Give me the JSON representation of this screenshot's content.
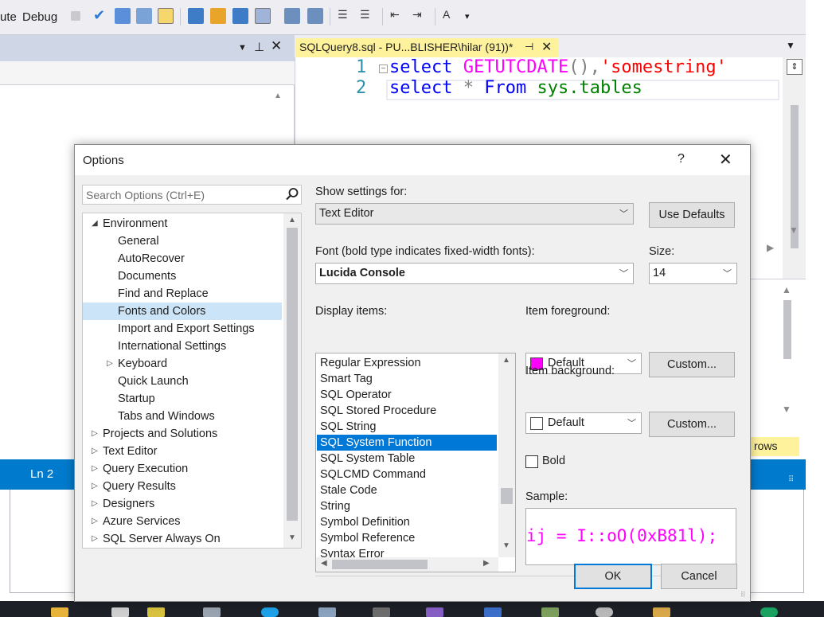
{
  "menubar": {
    "items": [
      "ute",
      "Debug"
    ]
  },
  "editor": {
    "tab_title": "SQLQuery8.sql - PU...BLISHER\\hilar (91))*",
    "line_numbers": [
      "1",
      "2"
    ],
    "line1": {
      "kw": "select",
      "fn": "GETUTCDATE",
      "paren": "()",
      "comma": ",",
      "str": "'somestring'"
    },
    "line2": {
      "kw": "select",
      "star": "*",
      "from": "From",
      "tbl": "sys.tables"
    }
  },
  "results_tag": "rows",
  "statusbar": {
    "line": "Ln 2"
  },
  "dialog": {
    "title": "Options",
    "help_glyph": "?",
    "search_placeholder": "Search Options (Ctrl+E)",
    "tree": [
      {
        "label": "Environment",
        "level": 0,
        "arrow": "expanded"
      },
      {
        "label": "General",
        "level": 1,
        "arrow": "none"
      },
      {
        "label": "AutoRecover",
        "level": 1,
        "arrow": "none"
      },
      {
        "label": "Documents",
        "level": 1,
        "arrow": "none"
      },
      {
        "label": "Find and Replace",
        "level": 1,
        "arrow": "none"
      },
      {
        "label": "Fonts and Colors",
        "level": 1,
        "arrow": "none",
        "selected": true
      },
      {
        "label": "Import and Export Settings",
        "level": 1,
        "arrow": "none"
      },
      {
        "label": "International Settings",
        "level": 1,
        "arrow": "none"
      },
      {
        "label": "Keyboard",
        "level": 1,
        "arrow": "collapsed"
      },
      {
        "label": "Quick Launch",
        "level": 1,
        "arrow": "none"
      },
      {
        "label": "Startup",
        "level": 1,
        "arrow": "none"
      },
      {
        "label": "Tabs and Windows",
        "level": 1,
        "arrow": "none"
      },
      {
        "label": "Projects and Solutions",
        "level": 0,
        "arrow": "collapsed"
      },
      {
        "label": "Text Editor",
        "level": 0,
        "arrow": "collapsed"
      },
      {
        "label": "Query Execution",
        "level": 0,
        "arrow": "collapsed"
      },
      {
        "label": "Query Results",
        "level": 0,
        "arrow": "collapsed"
      },
      {
        "label": "Designers",
        "level": 0,
        "arrow": "collapsed"
      },
      {
        "label": "Azure Services",
        "level": 0,
        "arrow": "collapsed"
      },
      {
        "label": "SQL Server Always On",
        "level": 0,
        "arrow": "collapsed"
      }
    ],
    "show_settings_label": "Show settings for:",
    "show_settings_value": "Text Editor",
    "use_defaults": "Use Defaults",
    "font_label": "Font (bold type indicates fixed-width fonts):",
    "font_value": "Lucida Console",
    "size_label": "Size:",
    "size_value": "14",
    "display_items_label": "Display items:",
    "display_items": [
      "Regular Expression",
      "Smart Tag",
      "SQL Operator",
      "SQL Stored Procedure",
      "SQL String",
      "SQL System Function",
      "SQL System Table",
      "SQLCMD Command",
      "Stale Code",
      "String",
      "Symbol Definition",
      "Symbol Reference",
      "Syntax Error"
    ],
    "selected_display_item": "SQL System Function",
    "item_fg_label": "Item foreground:",
    "item_fg_value": "Default",
    "item_fg_color": "#ff00ff",
    "item_bg_label": "Item background:",
    "item_bg_value": "Default",
    "item_bg_color": "#ffffff",
    "custom_label": "Custom...",
    "bold_label": "Bold",
    "bold_checked": false,
    "sample_label": "Sample:",
    "sample_text": "ij = I::oO(0xB81l);",
    "ok": "OK",
    "cancel": "Cancel"
  },
  "colors": {
    "accent": "#007acc",
    "tab_highlight": "#fff29d",
    "selection": "#0078d7",
    "tree_selection": "#cce4f7"
  }
}
